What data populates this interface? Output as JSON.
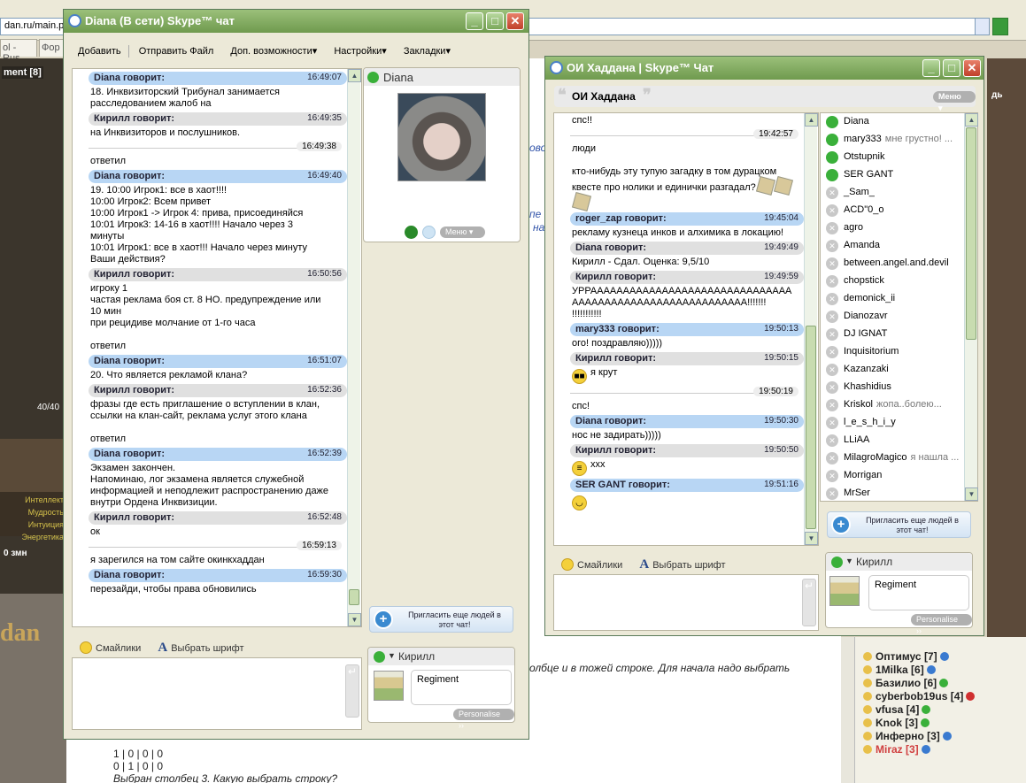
{
  "browser": {
    "address": "dan.ru/main.ph",
    "tabs": [
      "ol - Rus...",
      "Фор"
    ],
    "game_label": "ment [8]",
    "hp": "40/40",
    "stats": [
      "Интеллект",
      "Мудрость",
      "Интуиция",
      "Энергетика"
    ],
    "money": "0 змн",
    "logo": "dan",
    "right_label": "дь",
    "bg_text": [
      "олбце и в тожей строке. Для начала надо выбрать",
      "1 | 0 | 0 | 0",
      "0 | 1 | 0 | 0",
      "Выбран столбец 3. Какую выбрать строку?"
    ],
    "bg_links": [
      "ово",
      "пе",
      "на"
    ],
    "bg_users": [
      {
        "name": "Оптимус [7]",
        "color": "#3a7ad0"
      },
      {
        "name": "1Milka [6]",
        "color": "#3a7ad0"
      },
      {
        "name": "Базилио [6]",
        "color": "#3ab03a"
      },
      {
        "name": "cyberbob19us [4]",
        "color": "#d03030"
      },
      {
        "name": "vfusa [4]",
        "color": "#3ab03a"
      },
      {
        "name": "Knok [3]",
        "color": "#3ab03a"
      },
      {
        "name": "Инферно [3]",
        "color": "#3a7ad0"
      },
      {
        "name": "Miraz [3]",
        "color": "#3a7ad0"
      }
    ]
  },
  "win1": {
    "title": "Diana (В сети) Skype™ чат",
    "menu": [
      "Добавить",
      "Отправить Файл",
      "Доп. возможности▾",
      "Настройки▾",
      "Закладки▾"
    ],
    "messages": [
      {
        "type": "head",
        "color": "blue",
        "who": "Diana говорит:",
        "time": "16:49:07",
        "text": "18. Инквизиторский Трибунал занимается\nрасследованием жалоб на"
      },
      {
        "type": "head",
        "color": "gray",
        "who": "Кирилл говорит:",
        "time": "16:49:35",
        "text": "на Инквизиторов и послушников."
      },
      {
        "type": "line",
        "time": "16:49:38",
        "text": "ответил"
      },
      {
        "type": "head",
        "color": "blue",
        "who": "Diana говорит:",
        "time": "16:49:40",
        "text": "19. 10:00 Игрок1: все в хаот!!!!\n10:00 Игрок2: Всем привет\n10:00 Игрок1 -> Игрок 4: прива, присоединяйся\n10:01 Игрок3: 14-16 в хаот!!!! Начало через 3\nминуты\n10:01 Игрок1: все в хаот!!! Начало через минуту\nВаши действия?"
      },
      {
        "type": "head",
        "color": "gray",
        "who": "Кирилл говорит:",
        "time": "16:50:56",
        "text": "игроку 1\nчастая реклама боя ст. 8 НО.  предупреждение или\n10 мин\nпри рецидиве молчание от 1-го часа\n\nответил"
      },
      {
        "type": "head",
        "color": "blue",
        "who": "Diana говорит:",
        "time": "16:51:07",
        "text": "20. Что является рекламой клана?"
      },
      {
        "type": "head",
        "color": "gray",
        "who": "Кирилл говорит:",
        "time": "16:52:36",
        "text": "фразы где есть приглашение о вступлении в клан,\nссылки на клан-сайт, реклама услуг этого клана\n\nответил"
      },
      {
        "type": "head",
        "color": "blue",
        "who": "Diana говорит:",
        "time": "16:52:39",
        "text": "Экзамен закончен.\nНапоминаю, лог экзамена является служебной\nинформацией и неподлежит распространению даже\nвнутри Ордена Инквизиции."
      },
      {
        "type": "head",
        "color": "gray",
        "who": "Кирилл говорит:",
        "time": "16:52:48",
        "text": "ок"
      },
      {
        "type": "line",
        "time": "16:59:13",
        "text": "я зарегился на том сайте окинкхаддан"
      },
      {
        "type": "head",
        "color": "blue",
        "who": "Diana говорит:",
        "time": "16:59:30",
        "text": "перезайди, чтобы права обновились"
      }
    ],
    "contact_name": "Diana",
    "menu_btn": "Меню",
    "invite": "Пригласить еще людей в\nэтот чат!",
    "toolstrip": {
      "smileys": "Смайлики",
      "font": "Выбрать шрифт"
    },
    "me": {
      "name": "Кирилл",
      "mood": "Regiment",
      "personalise": "Personalise ››"
    }
  },
  "win2": {
    "title": "ОИ Хаддана | Skype™ Чат",
    "header": "ОИ Хаддана",
    "menu_btn": "Меню",
    "messages": [
      {
        "type": "plain",
        "text": "спс!!"
      },
      {
        "type": "line",
        "time": "19:42:57",
        "text": "люди\n\nкто-нибудь эту тупую загадку в том дурацком\nквесте про нолики и единички разгадал?",
        "puzzles": 3
      },
      {
        "type": "head",
        "color": "blue",
        "who": "roger_zap говорит:",
        "time": "19:45:04",
        "text": "рекламу кузнеца инков и алхимика в локацию!"
      },
      {
        "type": "head",
        "color": "gray",
        "who": "Diana говорит:",
        "time": "19:49:49",
        "text": "Кирилл - Сдал. Оценка: 9,5/10"
      },
      {
        "type": "head",
        "color": "gray",
        "who": "Кирилл говорит:",
        "time": "19:49:59",
        "text": "УРРААААААААААААААААААААААААААААААА\nААААААААААААААААААААААААААА!!!!!!!\n!!!!!!!!!!!"
      },
      {
        "type": "head",
        "color": "blue",
        "who": "mary333 говорит:",
        "time": "19:50:13",
        "text": "ого! поздравляю)))))"
      },
      {
        "type": "head",
        "color": "gray",
        "who": "Кирилл говорит:",
        "time": "19:50:15",
        "text": "я крут",
        "emo": "cool"
      },
      {
        "type": "line",
        "time": "19:50:19",
        "text": "спс!"
      },
      {
        "type": "head",
        "color": "blue",
        "who": "Diana говорит:",
        "time": "19:50:30",
        "text": "нос не задирать)))))"
      },
      {
        "type": "head",
        "color": "gray",
        "who": "Кирилл говорит:",
        "time": "19:50:50",
        "text": "ххх",
        "emo": "grin"
      },
      {
        "type": "head",
        "color": "blue",
        "who": "SER GANT говорит:",
        "time": "19:51:16",
        "text": "",
        "emo": "smile"
      }
    ],
    "contacts": [
      {
        "name": "Diana",
        "on": true,
        "mood": ""
      },
      {
        "name": "mary333",
        "on": true,
        "mood": "мне грустно! ..."
      },
      {
        "name": "Otstupnik",
        "on": true,
        "mood": ""
      },
      {
        "name": "SER GANT",
        "on": true,
        "mood": ""
      },
      {
        "name": "_Sam_",
        "on": false,
        "mood": ""
      },
      {
        "name": "ACD\"0_o",
        "on": false,
        "mood": ""
      },
      {
        "name": "agro",
        "on": false,
        "mood": ""
      },
      {
        "name": "Amanda",
        "on": false,
        "mood": ""
      },
      {
        "name": "between.angel.and.devil",
        "on": false,
        "mood": ""
      },
      {
        "name": "chopstick",
        "on": false,
        "mood": ""
      },
      {
        "name": "demonick_ii",
        "on": false,
        "mood": ""
      },
      {
        "name": "Dianozavr",
        "on": false,
        "mood": ""
      },
      {
        "name": "DJ IGNAT",
        "on": false,
        "mood": ""
      },
      {
        "name": "Inquisitorium",
        "on": false,
        "mood": ""
      },
      {
        "name": "Kazanzaki",
        "on": false,
        "mood": ""
      },
      {
        "name": "Khashidius",
        "on": false,
        "mood": ""
      },
      {
        "name": "Kriskol",
        "on": false,
        "mood": "жопа..болею..."
      },
      {
        "name": "l_e_s_h_i_y",
        "on": false,
        "mood": ""
      },
      {
        "name": "LLiAA",
        "on": false,
        "mood": ""
      },
      {
        "name": "MilagroMagico",
        "on": false,
        "mood": "я нашла ..."
      },
      {
        "name": "Morrigan",
        "on": false,
        "mood": ""
      },
      {
        "name": "MrSer",
        "on": false,
        "mood": ""
      }
    ],
    "invite": "Пригласить еще людей в\nэтот чат!",
    "toolstrip": {
      "smileys": "Смайлики",
      "font": "Выбрать шрифт"
    },
    "me": {
      "name": "Кирилл",
      "mood": "Regiment",
      "personalise": "Personalise ››"
    }
  }
}
